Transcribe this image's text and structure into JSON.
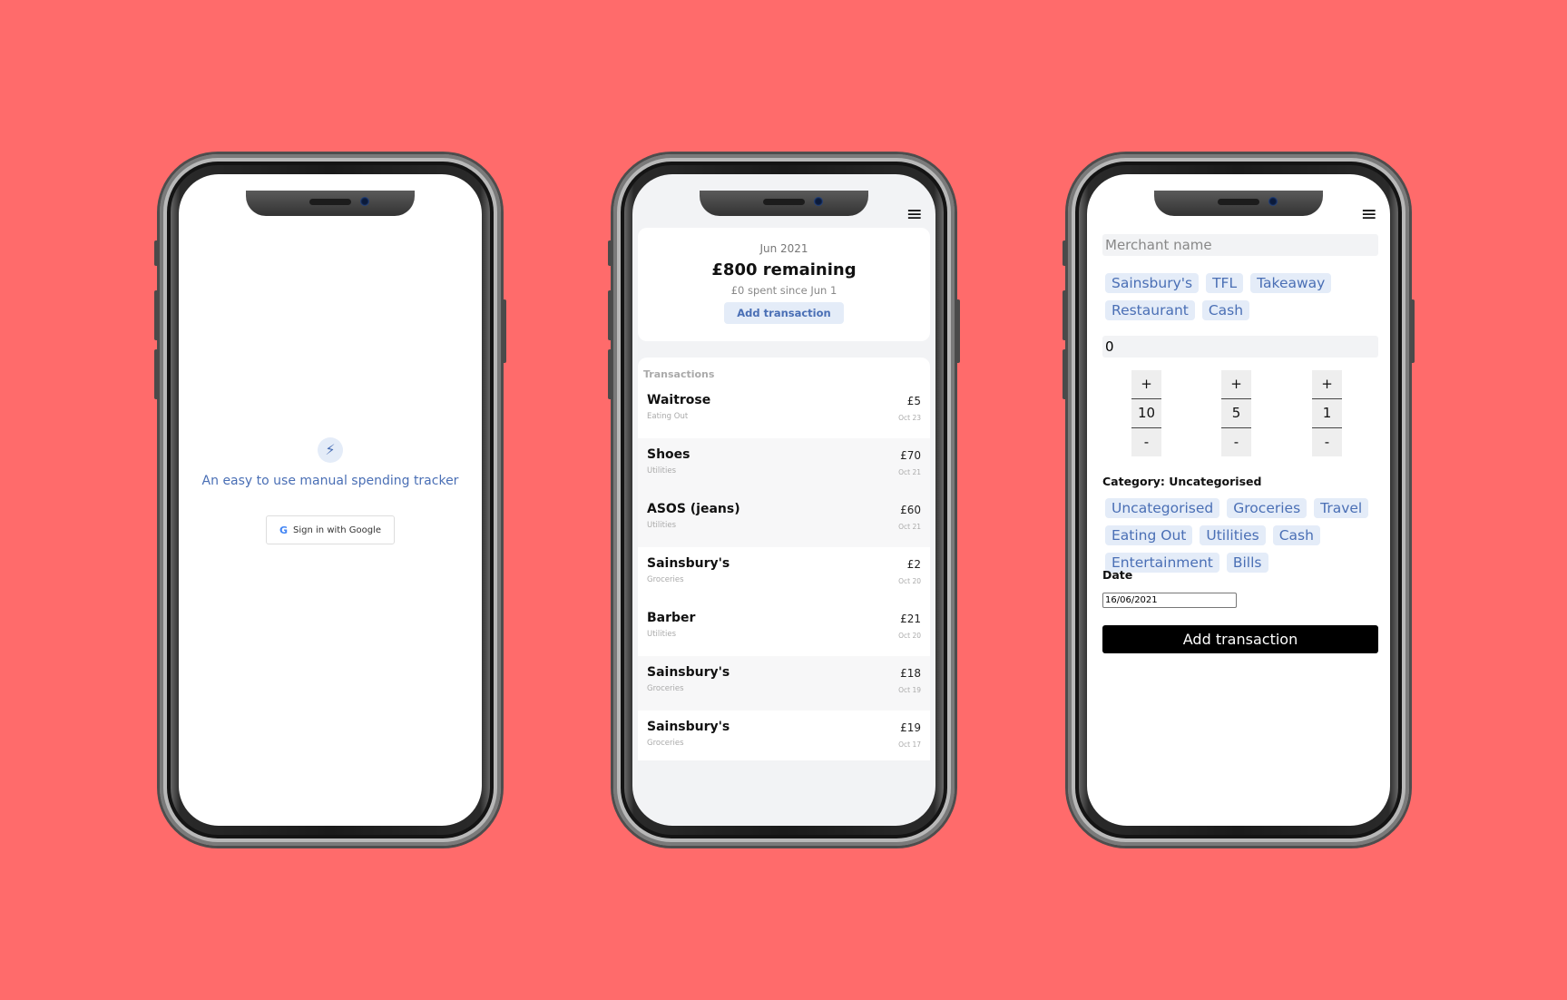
{
  "login": {
    "icon": "lightning-bolt-icon",
    "tagline": "An easy to use manual spending tracker",
    "google_button": "Sign in with Google",
    "google_glyph": "G"
  },
  "dashboard": {
    "menu_icon": "≡",
    "month": "Jun 2021",
    "remaining": "£800 remaining",
    "spent": "£0 spent since Jun 1",
    "add_button": "Add transaction",
    "transactions_header": "Transactions",
    "transactions": [
      {
        "name": "Waitrose",
        "category": "Eating Out",
        "amount": "£5",
        "date": "Oct 23"
      },
      {
        "name": "Shoes",
        "category": "Utilities",
        "amount": "£70",
        "date": "Oct 21"
      },
      {
        "name": "ASOS (jeans)",
        "category": "Utilities",
        "amount": "£60",
        "date": "Oct 21"
      },
      {
        "name": "Sainsbury's",
        "category": "Groceries",
        "amount": "£2",
        "date": "Oct 20"
      },
      {
        "name": "Barber",
        "category": "Utilities",
        "amount": "£21",
        "date": "Oct 20"
      },
      {
        "name": "Sainsbury's",
        "category": "Groceries",
        "amount": "£18",
        "date": "Oct 19"
      },
      {
        "name": "Sainsbury's",
        "category": "Groceries",
        "amount": "£19",
        "date": "Oct 17"
      }
    ]
  },
  "add_form": {
    "menu_icon": "≡",
    "merchant_placeholder": "Merchant name",
    "merchant_suggestions": [
      "Sainsbury's",
      "TFL",
      "Takeaway",
      "Restaurant",
      "Cash"
    ],
    "amount_value": "0",
    "steppers": [
      {
        "plus": "+",
        "value": "10",
        "minus": "-"
      },
      {
        "plus": "+",
        "value": "5",
        "minus": "-"
      },
      {
        "plus": "+",
        "value": "1",
        "minus": "-"
      }
    ],
    "category_label": "Category: Uncategorised",
    "categories": [
      "Uncategorised",
      "Groceries",
      "Travel",
      "Eating Out",
      "Utilities",
      "Cash",
      "Entertainment",
      "Bills"
    ],
    "date_label": "Date",
    "date_value": "16/06/2021",
    "submit_button": "Add transaction"
  }
}
